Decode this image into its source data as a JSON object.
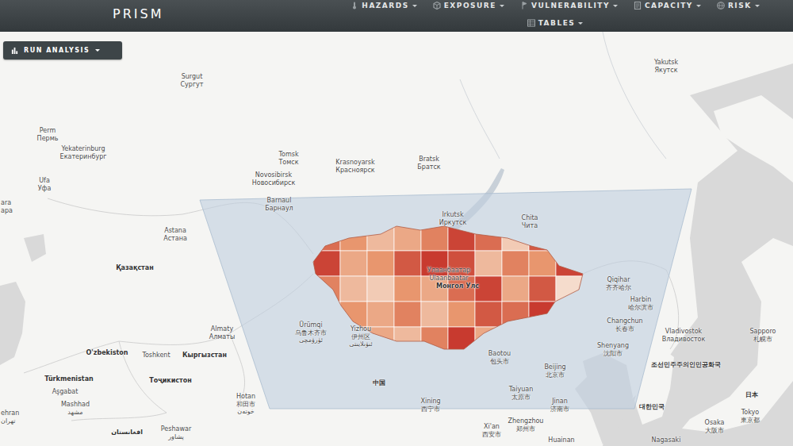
{
  "app": {
    "title": "PRISM"
  },
  "menu_rows": [
    [
      {
        "label": "HAZARDS"
      },
      {
        "label": "EXPOSURE"
      },
      {
        "label": "VULNERABILITY"
      },
      {
        "label": "CAPACITY"
      },
      {
        "label": "RISK"
      }
    ],
    [
      {
        "label": "TABLES"
      }
    ]
  ],
  "run_analysis": {
    "label": "RUN ANALYSIS"
  },
  "map": {
    "labels": [
      {
        "lines": [
          "Surgut",
          "Сургут"
        ],
        "kind": "city"
      },
      {
        "lines": [
          "Perm",
          "Пермь"
        ],
        "kind": "city"
      },
      {
        "lines": [
          "Yekaterinburg",
          "Екатеринбург"
        ],
        "kind": "city"
      },
      {
        "lines": [
          "Ufa",
          "Уфа"
        ],
        "kind": "city"
      },
      {
        "lines": [
          "ara",
          "ара"
        ],
        "kind": "city"
      },
      {
        "lines": [
          "Tomsk",
          "Томск"
        ],
        "kind": "city"
      },
      {
        "lines": [
          "Novosibirsk",
          "Новосибирск"
        ],
        "kind": "city"
      },
      {
        "lines": [
          "Krasnoyarsk",
          "Красноярск"
        ],
        "kind": "city"
      },
      {
        "lines": [
          "Bratsk",
          "Братск"
        ],
        "kind": "city"
      },
      {
        "lines": [
          "Yakutsk",
          "Якутск"
        ],
        "kind": "city"
      },
      {
        "lines": [
          "Barnaul",
          "Барнаул"
        ],
        "kind": "city"
      },
      {
        "lines": [
          "Astana",
          "Астана"
        ],
        "kind": "city"
      },
      {
        "lines": [
          "Irkutsk",
          "Иркутск"
        ],
        "kind": "city"
      },
      {
        "lines": [
          "Chita",
          "Чита"
        ],
        "kind": "city"
      },
      {
        "lines": [
          "Қазақстан"
        ],
        "kind": "country"
      },
      {
        "lines": [
          "Улаанбаатар",
          "Ulaanbaatar"
        ],
        "kind": "city"
      },
      {
        "lines": [
          "Монгол Улс"
        ],
        "kind": "country"
      },
      {
        "lines": [
          "Qiqihar",
          "齐齐哈尔"
        ],
        "kind": "city"
      },
      {
        "lines": [
          "Harbin",
          "哈尔滨市"
        ],
        "kind": "city"
      },
      {
        "lines": [
          "Changchun",
          "长春市"
        ],
        "kind": "city"
      },
      {
        "lines": [
          "Shenyang",
          "沈阳市"
        ],
        "kind": "city"
      },
      {
        "lines": [
          "Vladivostok",
          "Владивосток"
        ],
        "kind": "city"
      },
      {
        "lines": [
          "Sapporo",
          "札幌市"
        ],
        "kind": "city"
      },
      {
        "lines": [
          "조선민주주의인민공화국"
        ],
        "kind": "country"
      },
      {
        "lines": [
          "대한민국"
        ],
        "kind": "country"
      },
      {
        "lines": [
          "日本"
        ],
        "kind": "country"
      },
      {
        "lines": [
          "Tokyo",
          "東京都"
        ],
        "kind": "city"
      },
      {
        "lines": [
          "Osaka",
          "大阪市"
        ],
        "kind": "city"
      },
      {
        "lines": [
          "Nagasaki"
        ],
        "kind": "city"
      },
      {
        "lines": [
          "Almaty",
          "Алматы"
        ],
        "kind": "city"
      },
      {
        "lines": [
          "Ürümqi",
          "乌鲁木齐市",
          "ئۈرۈمچی"
        ],
        "kind": "city"
      },
      {
        "lines": [
          "Yizhou",
          "伊州区",
          "ئىۋىلايىتى"
        ],
        "kind": "city"
      },
      {
        "lines": [
          "Baotou",
          "包头市"
        ],
        "kind": "city"
      },
      {
        "lines": [
          "Beijing",
          "北京市"
        ],
        "kind": "city"
      },
      {
        "lines": [
          "Taiyuan",
          "太原市"
        ],
        "kind": "city"
      },
      {
        "lines": [
          "Jinan",
          "济南市"
        ],
        "kind": "city"
      },
      {
        "lines": [
          "Xining",
          "西宁市"
        ],
        "kind": "city"
      },
      {
        "lines": [
          "Zhengzhou",
          "郑州市"
        ],
        "kind": "city"
      },
      {
        "lines": [
          "Xi'an",
          "西安市"
        ],
        "kind": "city"
      },
      {
        "lines": [
          "Huainan"
        ],
        "kind": "city"
      },
      {
        "lines": [
          "中国"
        ],
        "kind": "country"
      },
      {
        "lines": [
          "O'zbekiston"
        ],
        "kind": "country"
      },
      {
        "lines": [
          "Toshkent"
        ],
        "kind": "city"
      },
      {
        "lines": [
          "Кыргызстан"
        ],
        "kind": "country"
      },
      {
        "lines": [
          "Türkmenistan"
        ],
        "kind": "country"
      },
      {
        "lines": [
          "Aşgabat"
        ],
        "kind": "city"
      },
      {
        "lines": [
          "Mashhad",
          "مشهد"
        ],
        "kind": "city"
      },
      {
        "lines": [
          "Тоҷикистон"
        ],
        "kind": "country"
      },
      {
        "lines": [
          "Hotan",
          "和田市",
          "خوتەن"
        ],
        "kind": "city"
      },
      {
        "lines": [
          "Peshawar",
          "پشاور"
        ],
        "kind": "city"
      },
      {
        "lines": [
          "افغانستان"
        ],
        "kind": "country"
      },
      {
        "lines": [
          "ehran",
          "تهران"
        ],
        "kind": "city"
      }
    ],
    "regions": [
      {
        "level": 0.7
      },
      {
        "level": 0.5
      },
      {
        "level": 0.3
      },
      {
        "level": 0.4
      },
      {
        "level": 0.6
      },
      {
        "level": 0.9
      },
      {
        "level": 0.7
      },
      {
        "level": 0.2
      },
      {
        "level": 0.8
      },
      {
        "level": 0.3
      },
      {
        "level": 0.9
      },
      {
        "level": 0.4
      },
      {
        "level": 0.5
      },
      {
        "level": 0.8
      },
      {
        "level": 0.95
      },
      {
        "level": 0.85
      },
      {
        "level": 0.3
      },
      {
        "level": 0.6
      },
      {
        "level": 0.5
      },
      {
        "level": 0.9
      },
      {
        "level": 0.6
      },
      {
        "level": 0.3
      },
      {
        "level": 0.2
      },
      {
        "level": 0.5
      },
      {
        "level": 0.4
      },
      {
        "level": 0.7
      },
      {
        "level": 0.9
      },
      {
        "level": 0.4
      },
      {
        "level": 0.8
      },
      {
        "level": 0.1
      },
      {
        "level": 0.3
      },
      {
        "level": 0.5
      },
      {
        "level": 0.4
      },
      {
        "level": 0.6
      },
      {
        "level": 0.3
      },
      {
        "level": 0.5
      },
      {
        "level": 0.8
      },
      {
        "level": 0.7
      },
      {
        "level": 0.95
      },
      {
        "level": 0.2
      },
      {
        "level": 0.1
      },
      {
        "level": 0.2
      },
      {
        "level": 0.4
      },
      {
        "level": 0.3
      },
      {
        "level": 0.6
      },
      {
        "level": 0.95
      },
      {
        "level": 0.4
      },
      {
        "level": 0.3
      },
      {
        "level": 0.2
      },
      {
        "level": 0.1
      }
    ]
  }
}
